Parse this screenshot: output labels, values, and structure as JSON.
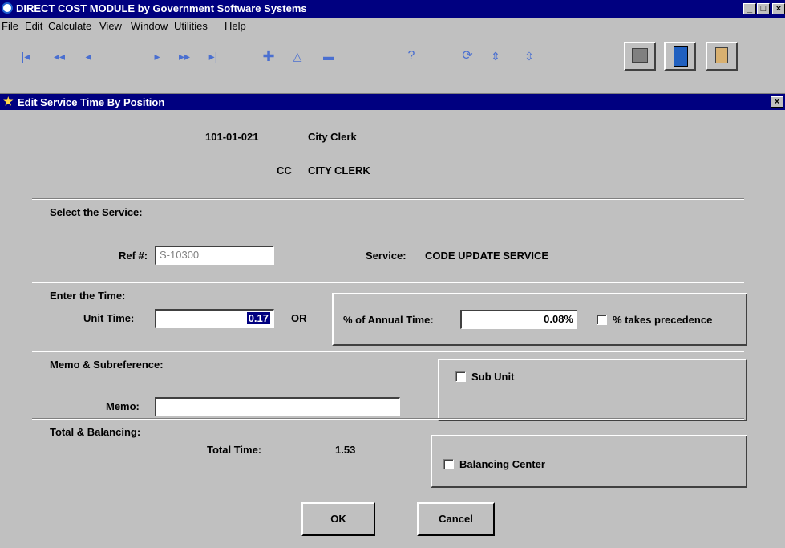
{
  "app": {
    "title": "DIRECT COST MODULE by Government Software Systems",
    "window_controls": [
      "_",
      "□",
      "×"
    ]
  },
  "menu": {
    "items": [
      "File",
      "Edit",
      "Calculate",
      "View",
      "Window",
      "Utilities",
      "Help"
    ]
  },
  "toolbar": {
    "nav_icons": [
      "first-record-icon",
      "previous-page-icon",
      "previous-record-icon",
      "next-record-icon",
      "next-page-icon",
      "last-record-icon"
    ],
    "edit_icons": [
      "add-record-icon",
      "edit-record-icon",
      "delete-record-icon"
    ],
    "help_icon": "help-icon",
    "other_icons": [
      "refresh-icon",
      "sort-icon",
      "filter-icon"
    ],
    "tool_buttons": [
      "printer-icon",
      "calculator-icon",
      "clipboard-icon"
    ]
  },
  "dialog": {
    "title": "Edit Service Time By Position",
    "header": {
      "position_code": "101-01-021",
      "position_name": "City Clerk",
      "dept_code": "CC",
      "dept_name": "CITY CLERK"
    },
    "select_service": {
      "section_label": "Select the Service:",
      "ref_label": "Ref #:",
      "ref_value": "S-10300",
      "service_label": "Service:",
      "service_value": "CODE UPDATE SERVICE"
    },
    "time": {
      "section_label": "Enter the Time:",
      "unit_time_label": "Unit Time:",
      "unit_time_value": "0.17",
      "or_label": "OR",
      "annual_label": "% of Annual Time:",
      "annual_value": "0.08%",
      "precedence_label": "% takes precedence",
      "precedence_checked": false
    },
    "memo": {
      "section_label": "Memo & Subreference:",
      "memo_label": "Memo:",
      "memo_value": "",
      "sub_unit_label": "Sub Unit",
      "sub_unit_checked": false
    },
    "totals": {
      "section_label": "Total & Balancing:",
      "total_time_label": "Total Time:",
      "total_time_value": "1.53",
      "balancing_label": "Balancing Center",
      "balancing_checked": false
    },
    "buttons": {
      "ok": "OK",
      "cancel": "Cancel"
    }
  }
}
